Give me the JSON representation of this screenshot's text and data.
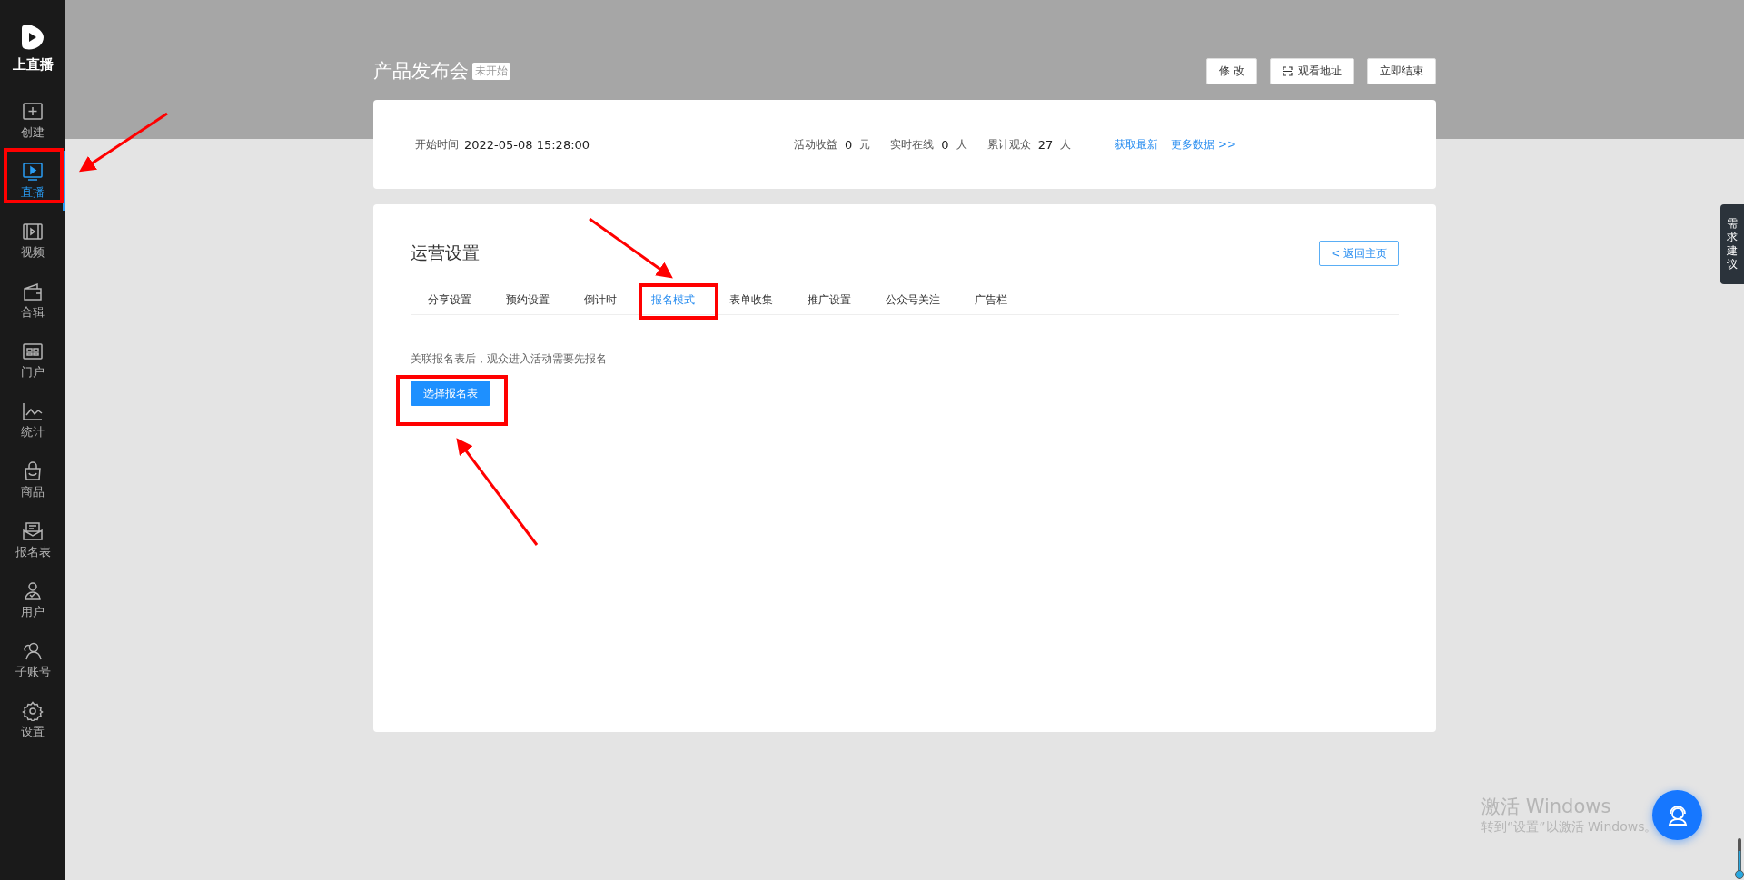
{
  "sidebar": {
    "logo_text": "上直播",
    "items": [
      {
        "label": "创建",
        "selected": false
      },
      {
        "label": "直播",
        "selected": true
      },
      {
        "label": "视频",
        "selected": false
      },
      {
        "label": "合辑",
        "selected": false
      },
      {
        "label": "门户",
        "selected": false
      },
      {
        "label": "统计",
        "selected": false
      },
      {
        "label": "商品",
        "selected": false
      },
      {
        "label": "报名表",
        "selected": false
      },
      {
        "label": "用户",
        "selected": false
      },
      {
        "label": "子账号",
        "selected": false
      },
      {
        "label": "设置",
        "selected": false
      }
    ]
  },
  "header": {
    "title": "产品发布会",
    "status": "未开始",
    "buttons": [
      {
        "kind": "plain",
        "label": "修 改"
      },
      {
        "kind": "scan",
        "label": "观看地址"
      },
      {
        "kind": "plain",
        "label": "立即结束"
      }
    ]
  },
  "info": {
    "start_label": "开始时间",
    "start_value": "2022-05-08 15:28:00",
    "stats": [
      {
        "label": "活动收益",
        "value": "0",
        "unit": "元"
      },
      {
        "label": "实时在线",
        "value": "0",
        "unit": "人"
      },
      {
        "label": "累计观众",
        "value": "27",
        "unit": "人"
      }
    ],
    "links": [
      "获取最新",
      "更多数据 >>"
    ]
  },
  "settings": {
    "title": "运营设置",
    "back_button": "< 返回主页",
    "tabs": [
      {
        "label": "分享设置",
        "selected": false
      },
      {
        "label": "预约设置",
        "selected": false
      },
      {
        "label": "倒计时",
        "selected": false
      },
      {
        "label": "报名模式",
        "selected": true
      },
      {
        "label": "表单收集",
        "selected": false
      },
      {
        "label": "推广设置",
        "selected": false
      },
      {
        "label": "公众号关注",
        "selected": false
      },
      {
        "label": "广告栏",
        "selected": false
      }
    ],
    "description": "关联报名表后，观众进入活动需要先报名",
    "primary_button": "选择报名表"
  },
  "feedback_tab": "需求建议",
  "windows_notice": {
    "title": "激活 Windows",
    "subtitle": "转到“设置”以激活 Windows。"
  }
}
